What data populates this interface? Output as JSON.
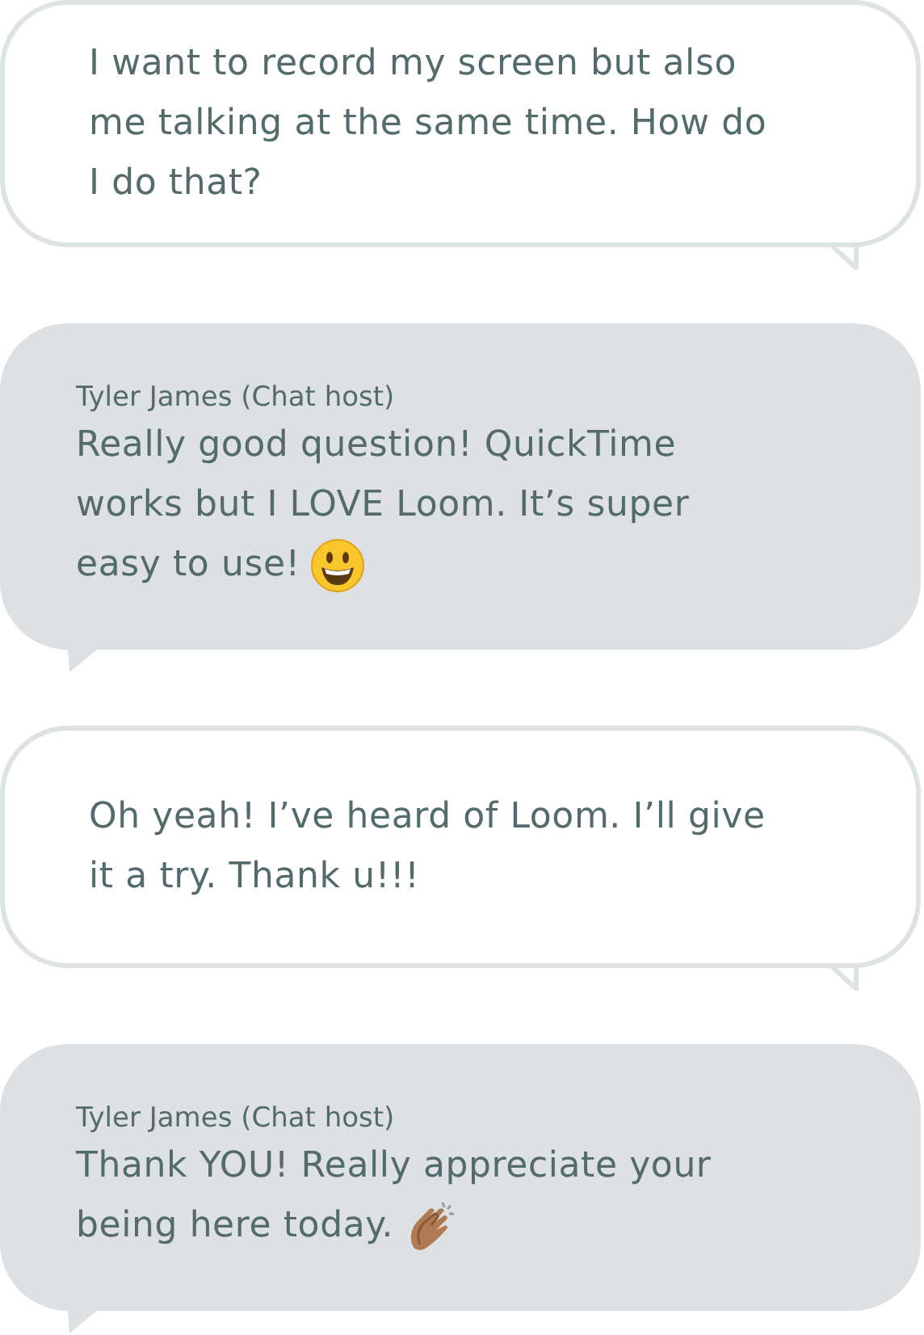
{
  "messages": [
    {
      "kind": "outgoing",
      "lines": [
        "I want to record my screen but also",
        "me talking at the same time. How do",
        "I do that?"
      ]
    },
    {
      "kind": "incoming",
      "sender": "Tyler James (Chat host)",
      "lines": [
        "Really good question! QuickTime",
        "works but I LOVE Loom. It’s super",
        "easy to use!"
      ],
      "end_icon": {
        "kind": "smile"
      }
    },
    {
      "kind": "outgoing",
      "lines": [
        "Oh yeah! I’ve heard of Loom. I’ll give",
        "it a try. Thank u!!!"
      ]
    },
    {
      "kind": "incoming",
      "sender": "Tyler James (Chat host)",
      "lines": [
        "Thank YOU! Really appreciate your",
        "being here today."
      ],
      "end_icon": {
        "kind": "clap"
      }
    }
  ]
}
